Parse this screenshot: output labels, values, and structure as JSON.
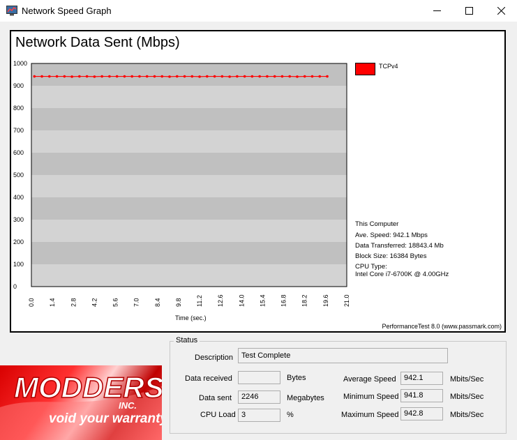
{
  "window": {
    "title": "Network Speed Graph"
  },
  "chart": {
    "title": "Network Data Sent (Mbps)",
    "x_axis_label": "Time (sec.)",
    "legend_label": "TCPv4",
    "credit": "PerformanceTest 8.0 (www.passmark.com)"
  },
  "info": {
    "heading": "This Computer",
    "ave_speed": "Ave. Speed: 942.1 Mbps",
    "data_transferred": "Data Transferred: 18843.4 Mb",
    "block_size": "Block Size: 16384 Bytes",
    "cpu_type_label": "CPU Type:",
    "cpu_type": "Intel Core i7-6700K @ 4.00GHz"
  },
  "status": {
    "group_label": "Status",
    "description_label": "Description",
    "description_value": "Test Complete",
    "data_received_label": "Data received",
    "data_received_value": "",
    "data_received_unit": "Bytes",
    "data_sent_label": "Data sent",
    "data_sent_value": "2246",
    "data_sent_unit": "Megabytes",
    "cpu_load_label": "CPU Load",
    "cpu_load_value": "3",
    "cpu_load_unit": "%",
    "avg_speed_label": "Average Speed",
    "avg_speed_value": "942.1",
    "min_speed_label": "Minimum Speed",
    "min_speed_value": "941.8",
    "max_speed_label": "Maximum Speed",
    "max_speed_value": "942.8",
    "speed_unit": "Mbits/Sec"
  },
  "logo": {
    "brand": "MODDERS",
    "suffix": "INC.",
    "tagline": "void your warranty"
  },
  "colors": {
    "series": "#ff0000",
    "plot_band_light": "#d3d3d3",
    "plot_band_dark": "#c0c0c0"
  },
  "chart_data": {
    "type": "line",
    "title": "Network Data Sent (Mbps)",
    "xlabel": "Time (sec.)",
    "ylabel": "",
    "xlim": [
      0,
      21
    ],
    "ylim": [
      0,
      1000
    ],
    "yticks": [
      0,
      100,
      200,
      300,
      400,
      500,
      600,
      700,
      800,
      900,
      1000
    ],
    "xticks": [
      "0.0",
      "1.4",
      "2.8",
      "4.2",
      "5.6",
      "7.0",
      "8.4",
      "9.8",
      "11.2",
      "12.6",
      "14.0",
      "15.4",
      "16.8",
      "18.2",
      "19.6",
      "21.0"
    ],
    "legend": "top-right",
    "series": [
      {
        "name": "TCPv4",
        "x": [
          0.2,
          0.7,
          1.2,
          1.7,
          2.2,
          2.7,
          3.2,
          3.7,
          4.2,
          4.7,
          5.2,
          5.7,
          6.2,
          6.7,
          7.2,
          7.7,
          8.2,
          8.7,
          9.2,
          9.7,
          10.2,
          10.7,
          11.2,
          11.7,
          12.2,
          12.7,
          13.2,
          13.7,
          14.2,
          14.7,
          15.2,
          15.7,
          16.2,
          16.7,
          17.2,
          17.7,
          18.2,
          18.7,
          19.2,
          19.7
        ],
        "y": [
          942,
          942,
          942,
          942,
          942,
          941,
          942,
          942,
          941,
          942,
          942,
          942,
          942,
          942,
          942,
          942,
          942,
          942,
          941,
          942,
          942,
          942,
          941,
          942,
          942,
          942,
          941,
          942,
          942,
          942,
          942,
          942,
          942,
          942,
          942,
          941,
          942,
          942,
          942,
          942
        ]
      }
    ]
  }
}
